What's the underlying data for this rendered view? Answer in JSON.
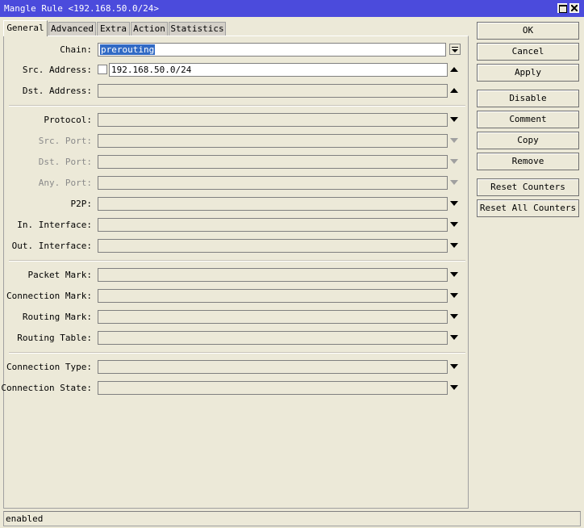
{
  "window": {
    "title": "Mangle Rule <192.168.50.0/24>"
  },
  "tabs": [
    "General",
    "Advanced",
    "Extra",
    "Action",
    "Statistics"
  ],
  "fields": {
    "chain": {
      "label": "Chain:",
      "value": "prerouting"
    },
    "src_address": {
      "label": "Src. Address:",
      "value": "192.168.50.0/24"
    },
    "dst_address": {
      "label": "Dst. Address:",
      "value": ""
    },
    "protocol": {
      "label": "Protocol:",
      "value": ""
    },
    "src_port": {
      "label": "Src. Port:",
      "value": ""
    },
    "dst_port": {
      "label": "Dst. Port:",
      "value": ""
    },
    "any_port": {
      "label": "Any. Port:",
      "value": ""
    },
    "p2p": {
      "label": "P2P:",
      "value": ""
    },
    "in_interface": {
      "label": "In. Interface:",
      "value": ""
    },
    "out_interface": {
      "label": "Out. Interface:",
      "value": ""
    },
    "packet_mark": {
      "label": "Packet Mark:",
      "value": ""
    },
    "connection_mark": {
      "label": "Connection Mark:",
      "value": ""
    },
    "routing_mark": {
      "label": "Routing Mark:",
      "value": ""
    },
    "routing_table": {
      "label": "Routing Table:",
      "value": ""
    },
    "connection_type": {
      "label": "Connection Type:",
      "value": ""
    },
    "connection_state": {
      "label": "Connection State:",
      "value": ""
    }
  },
  "buttons": {
    "ok": "OK",
    "cancel": "Cancel",
    "apply": "Apply",
    "disable": "Disable",
    "comment": "Comment",
    "copy": "Copy",
    "remove": "Remove",
    "reset_counters": "Reset Counters",
    "reset_all_counters": "Reset All Counters"
  },
  "status": "enabled",
  "colors": {
    "titlebar": "#4b4bdc",
    "background": "#ece9d8",
    "selection": "#316ac5"
  }
}
